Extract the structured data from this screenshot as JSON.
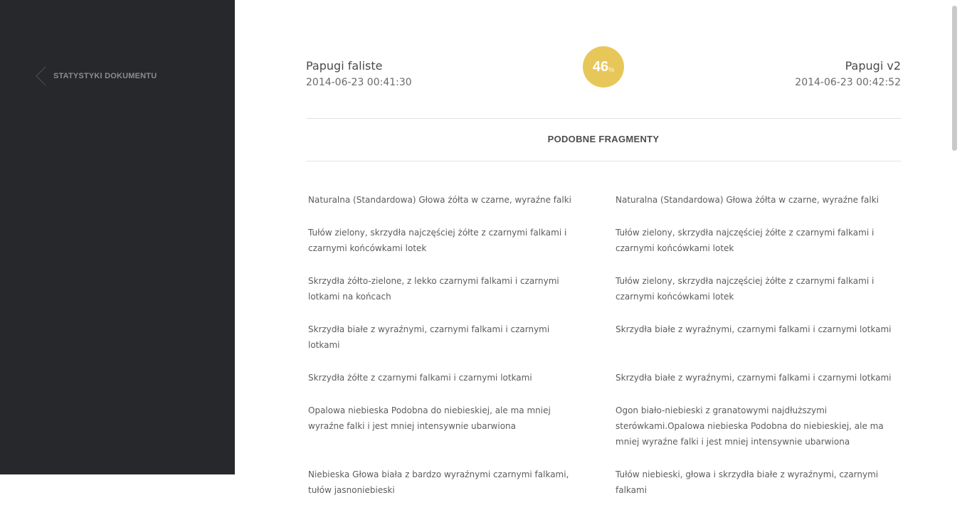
{
  "sidebar": {
    "back_label": "STATYSTYKI DOKUMENTU",
    "back_icon": "chevron-left-icon"
  },
  "comparison": {
    "left_doc": {
      "title": "Papugi faliste",
      "date": "2014-06-23 00:41:30"
    },
    "right_doc": {
      "title": "Papugi v2",
      "date": "2014-06-23 00:42:52"
    },
    "similarity": {
      "value": "46",
      "unit": "%",
      "color": "#e8c75a"
    }
  },
  "section_title": "PODOBNE FRAGMENTY",
  "fragments": [
    {
      "left": "Naturalna (Standardowa) Głowa żółta w czarne, wyraźne falki",
      "right": "Naturalna (Standardowa) Głowa żółta w czarne, wyraźne falki"
    },
    {
      "left": "Tułów zielony, skrzydła najczęściej żółte z czarnymi falkami i czarnymi końcówkami lotek",
      "right": "Tułów zielony, skrzydła najczęściej żółte z czarnymi falkami i czarnymi końcówkami lotek"
    },
    {
      "left": "Skrzydła żółto-zielone, z lekko czarnymi falkami i czarnymi lotkami na końcach",
      "right": "Tułów zielony, skrzydła najczęściej żółte z czarnymi falkami i czarnymi końcówkami lotek"
    },
    {
      "left": "Skrzydła białe z wyraźnymi, czarnymi falkami i czarnymi lotkami",
      "right": "Skrzydła białe z wyraźnymi, czarnymi falkami i czarnymi lotkami"
    },
    {
      "left": "Skrzydła żółte z czarnymi falkami i czarnymi lotkami",
      "right": "Skrzydła białe z wyraźnymi, czarnymi falkami i czarnymi lotkami"
    },
    {
      "left": "Opalowa niebieska Podobna do niebieskiej, ale ma mniej wyraźne falki i jest mniej intensywnie ubarwiona",
      "right": "Ogon biało-niebieski z granatowymi najdłuższymi sterówkami.Opalowa niebieska Podobna do niebieskiej, ale ma mniej wyraźne falki i jest mniej intensywnie ubarwiona"
    },
    {
      "left": "Niebieska Głowa biała z bardzo wyraźnymi czarnymi falkami, tułów jasnoniebieski",
      "right": "Tułów niebieski, głowa i skrzydła białe z wyraźnymi, czarnymi falkami"
    }
  ]
}
